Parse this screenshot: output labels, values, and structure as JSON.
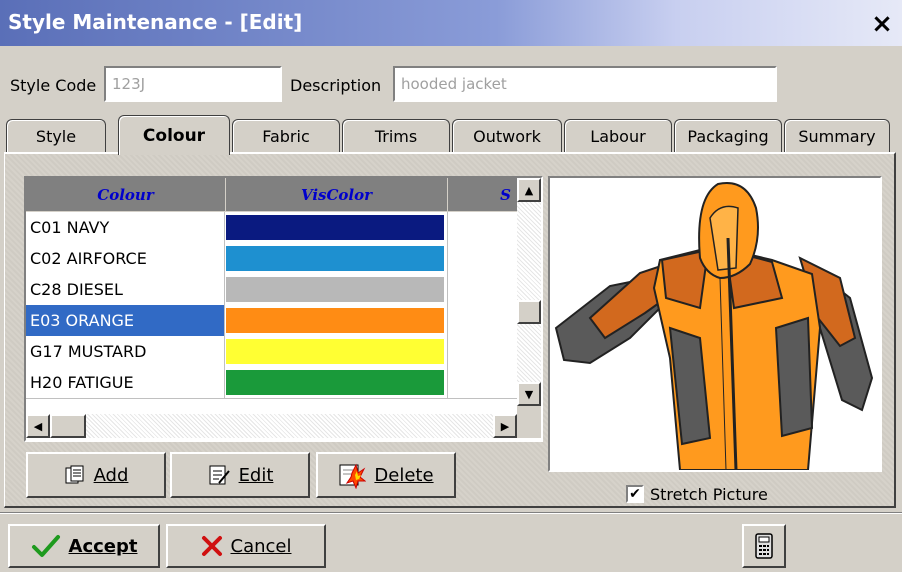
{
  "window": {
    "title": "Style Maintenance - [Edit]",
    "close_glyph": "×"
  },
  "header": {
    "style_code_label": "Style Code",
    "style_code_value": "123J",
    "description_label": "Description",
    "description_value": "hooded jacket"
  },
  "tabs": [
    {
      "label": "Style"
    },
    {
      "label": "Colour"
    },
    {
      "label": "Fabric"
    },
    {
      "label": "Trims"
    },
    {
      "label": "Outwork"
    },
    {
      "label": "Labour"
    },
    {
      "label": "Packaging"
    },
    {
      "label": "Summary"
    }
  ],
  "active_tab": "Colour",
  "grid": {
    "columns": [
      "Colour",
      "VisColor",
      "S"
    ],
    "rows": [
      {
        "name": "C01 NAVY",
        "color": "#0a1a80"
      },
      {
        "name": "C02 AIRFORCE",
        "color": "#1e90d0"
      },
      {
        "name": "C28 DIESEL",
        "color": "#b8b8b8"
      },
      {
        "name": "E03 ORANGE",
        "color": "#ff8c14",
        "selected": true
      },
      {
        "name": "G17 MUSTARD",
        "color": "#ffff33"
      },
      {
        "name": "H20 FATIGUE",
        "color": "#1a9a3a"
      }
    ]
  },
  "actions": {
    "add_label": "Add",
    "edit_label": "Edit",
    "delete_label": "Delete"
  },
  "picture": {
    "stretch_label": "Stretch Picture",
    "stretch_checked": true
  },
  "footer": {
    "accept_label": "Accept",
    "cancel_label": "Cancel"
  },
  "icons": [
    "close-icon",
    "add-icon",
    "edit-icon",
    "delete-icon",
    "checkmark-icon",
    "x-icon",
    "calculator-icon"
  ],
  "colors": {
    "title_bar": "#5a6fb8",
    "title_text": "#ffffff",
    "selection": "#316ac5",
    "header_bg": "#808080",
    "header_text": "#0000cc"
  }
}
